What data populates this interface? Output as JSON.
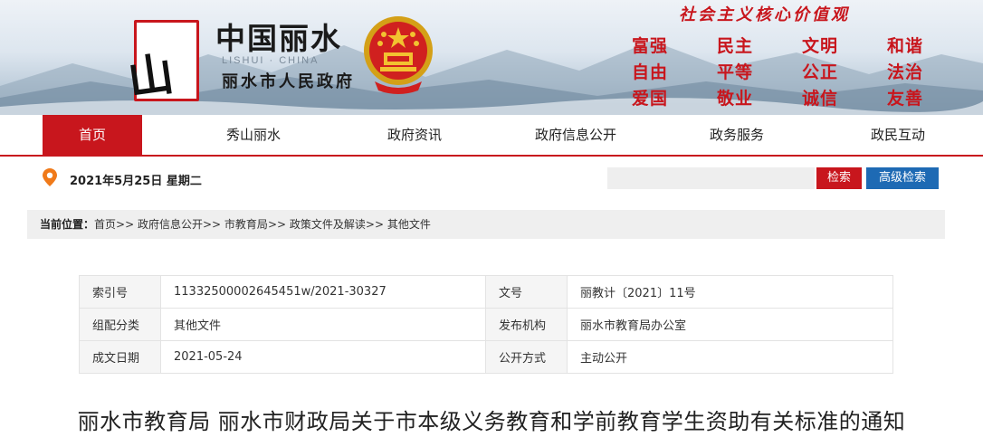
{
  "header": {
    "logo_glyph": "山",
    "site_name": "中国丽水",
    "site_en": "LISHUI · CHINA",
    "site_gov": "丽水市人民政府",
    "slogan": "社会主义核心价值观",
    "values": [
      "富强",
      "民主",
      "文明",
      "和谐",
      "自由",
      "平等",
      "公正",
      "法治",
      "爱国",
      "敬业",
      "诚信",
      "友善"
    ]
  },
  "nav": {
    "items": [
      "首页",
      "秀山丽水",
      "政府资讯",
      "政府信息公开",
      "政务服务",
      "政民互动"
    ],
    "active": "首页"
  },
  "toolbar": {
    "date": "2021年5月25日 星期二",
    "search_placeholder": "",
    "search_label": "检索",
    "advanced_label": "高级检索"
  },
  "breadcrumb": {
    "prefix": "当前位置：",
    "items": [
      "首页",
      "政府信息公开",
      "市教育局",
      "政策文件及解读",
      "其他文件"
    ],
    "separator": ">>"
  },
  "info": {
    "rows": [
      {
        "k1": "索引号",
        "v1": "11332500002645451w/2021-30327",
        "k2": "文号",
        "v2": "丽教计〔2021〕11号"
      },
      {
        "k1": "组配分类",
        "v1": "其他文件",
        "k2": "发布机构",
        "v2": "丽水市教育局办公室"
      },
      {
        "k1": "成文日期",
        "v1": "2021-05-24",
        "k2": "公开方式",
        "v2": "主动公开"
      }
    ]
  },
  "document": {
    "title": "丽水市教育局 丽水市财政局关于市本级义务教育和学前教育学生资助有关标准的通知"
  },
  "colors": {
    "brand_red": "#c8161d",
    "accent_blue": "#1e6ab4"
  }
}
